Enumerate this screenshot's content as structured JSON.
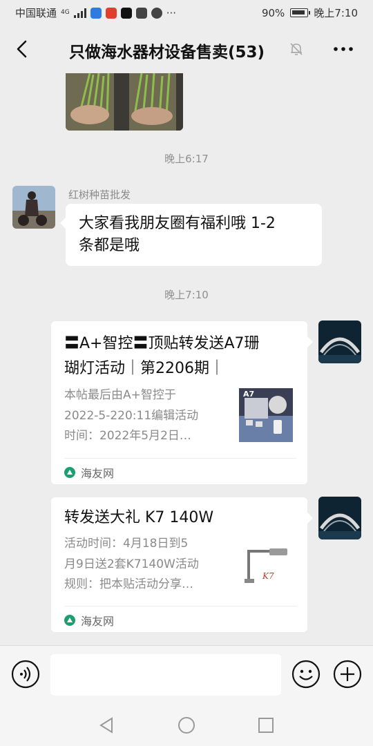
{
  "status": {
    "carrier": "中国联通",
    "network": "4G",
    "battery": "90%",
    "time": "晚上7:10",
    "overflow": "···"
  },
  "header": {
    "title": "只做海水器材设备售卖(53)"
  },
  "messages": {
    "time1": "晚上6:17",
    "sender1": "红树种苗批发",
    "text1_line1": "大家看我朋友圈有福利哦 1-2",
    "text1_line2": "条都是哦",
    "time2": "晚上7:10",
    "card1": {
      "title_line1": "〓A+智控〓顶贴转发送A7珊",
      "title_line2": "瑚灯活动｜第2206期｜",
      "desc_line1": "本帖最后由A+智控于",
      "desc_line2": "2022-5-220:11编辑活动",
      "desc_line3": "时间：2022年5月2日…",
      "thumb_label": "A7",
      "source": "海友网"
    },
    "card2": {
      "title": "转发送大礼 K7 140W",
      "desc_line1": "活动时间：4月18日到5",
      "desc_line2": "月9日送2套K7140W活动",
      "desc_line3": "规则：把本贴活动分享…",
      "thumb_label": "K7",
      "source": "海友网"
    }
  },
  "colors": {
    "background": "#ededed",
    "bubble": "#ffffff",
    "source_icon": "#1aa06e"
  }
}
